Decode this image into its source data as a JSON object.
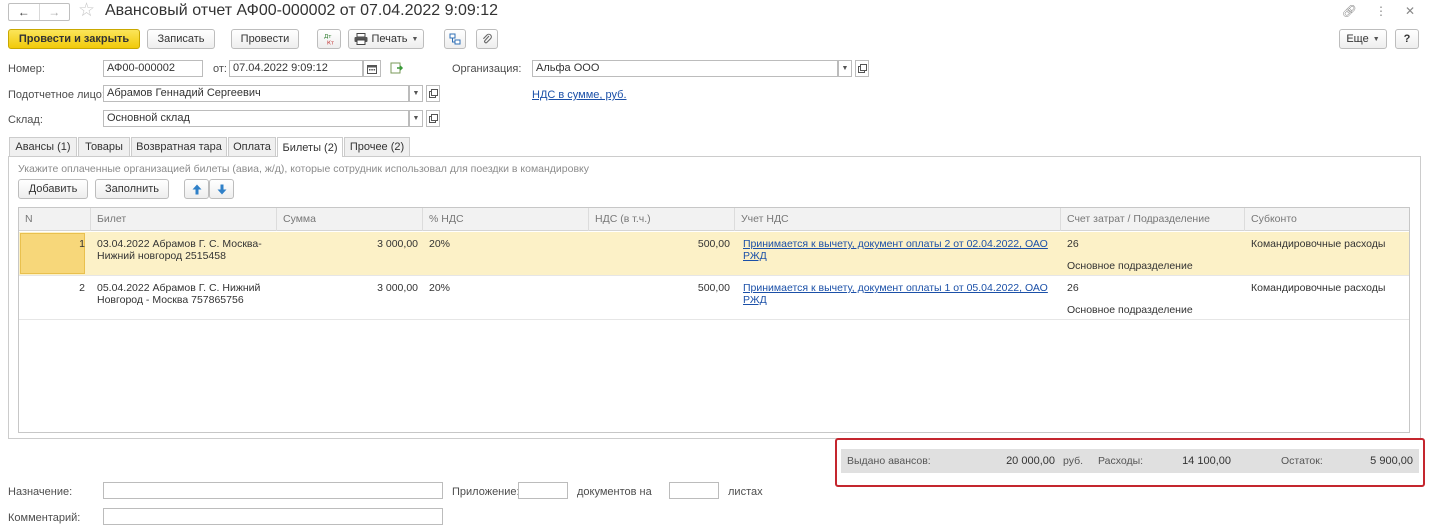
{
  "window": {
    "title": "Авансовый отчет АФ00-000002 от 07.04.2022 9:09:12"
  },
  "toolbar": {
    "post_close": "Провести и закрыть",
    "save": "Записать",
    "post": "Провести",
    "print": "Печать",
    "more": "Еще",
    "help": "?"
  },
  "form": {
    "number_label": "Номер:",
    "number_value": "АФ00-000002",
    "date_label": "от:",
    "date_value": "07.04.2022  9:09:12",
    "org_label": "Организация:",
    "org_value": "Альфа ООО",
    "person_label": "Подотчетное лицо:",
    "person_value": "Абрамов Геннадий Сергеевич",
    "vat_link": "НДС в сумме, руб.",
    "warehouse_label": "Склад:",
    "warehouse_value": "Основной склад"
  },
  "tabs": [
    {
      "label": "Авансы (1)"
    },
    {
      "label": "Товары"
    },
    {
      "label": "Возвратная тара"
    },
    {
      "label": "Оплата"
    },
    {
      "label": "Билеты (2)"
    },
    {
      "label": "Прочее (2)"
    }
  ],
  "tickets_tab": {
    "hint": "Укажите оплаченные организацией билеты (авиа, ж/д), которые сотрудник использовал для поездки в командировку",
    "add_button": "Добавить",
    "fill_button": "Заполнить"
  },
  "grid": {
    "columns": [
      "N",
      "Билет",
      "Сумма",
      "% НДС",
      "НДС (в т.ч.)",
      "Учет НДС",
      "Счет затрат / Подразделение",
      "Субконто"
    ],
    "rows": [
      {
        "n": "1",
        "ticket_1": "03.04.2022 Абрамов Г. С. Москва-",
        "ticket_2": "Нижний новгород 2515458",
        "amount": "3 000,00",
        "vat_rate": "20%",
        "vat_amount": "500,00",
        "vat_account_1": "Принимается к вычету, документ оплаты 2 от 02.04.2022, ОАО",
        "vat_account_2": "РЖД",
        "cost_account": "26",
        "department": "Основное подразделение",
        "subconto": "Командировочные расходы"
      },
      {
        "n": "2",
        "ticket_1": "05.04.2022 Абрамов Г. С. Нижний",
        "ticket_2": "Новгород - Москва 757865756",
        "amount": "3 000,00",
        "vat_rate": "20%",
        "vat_amount": "500,00",
        "vat_account_1": "Принимается к вычету, документ оплаты 1 от 05.04.2022, ОАО",
        "vat_account_2": "РЖД",
        "cost_account": "26",
        "department": "Основное подразделение",
        "subconto": "Командировочные расходы"
      }
    ]
  },
  "totals": {
    "advances_label": "Выдано авансов:",
    "advances_value": "20 000,00",
    "currency": "руб.",
    "expenses_label": "Расходы:",
    "expenses_value": "14 100,00",
    "balance_label": "Остаток:",
    "balance_value": "5 900,00"
  },
  "footer": {
    "purpose_label": "Назначение:",
    "attachment_label": "Приложение:",
    "docs_label": "документов на",
    "sheets_label": "листах",
    "comment_label": "Комментарий:"
  },
  "colors": {
    "primary_button": "#f1ca0a",
    "selected_row": "#fcf1c7",
    "link": "#1b50a8",
    "highlight_box": "#c4262e"
  }
}
